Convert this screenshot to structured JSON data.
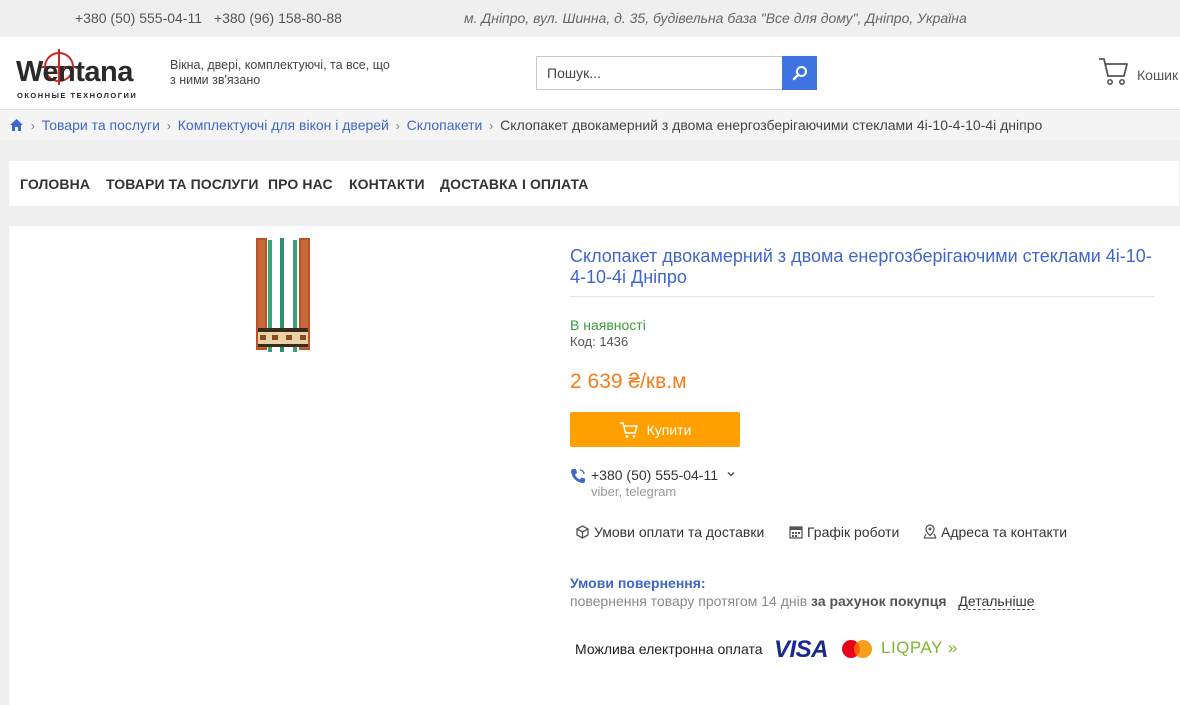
{
  "topbar": {
    "phone1": "+380 (50) 555-04-11",
    "phone2": "+380 (96) 158-80-88",
    "address": "м. Дніпро, вул. Шинна, д. 35, будівельна база \"Все для дому\", Дніпро, Україна"
  },
  "header": {
    "logo_text": "Wentana",
    "logo_sub": "ОКОННЫЕ ТЕХНОЛОГИИ",
    "tagline": "Вікна, двері, комплектуючі, та все, що з ними зв'язано",
    "search_placeholder": "Пошук...",
    "cart_label": "Кошик"
  },
  "breadcrumb": {
    "items": [
      "Товари та послуги",
      "Комплектуючі для вікон і дверей",
      "Склопакети"
    ],
    "current": "Склопакет двокамерний з двома енергозберігаючими стеклами 4і-10-4-10-4і дніпро"
  },
  "nav": {
    "items": [
      "ГОЛОВНА",
      "ТОВАРИ ТА ПОСЛУГИ",
      "ПРО НАС",
      "КОНТАКТИ",
      "ДОСТАВКА І ОПЛАТА"
    ]
  },
  "product": {
    "title": "Склопакет двокамерний з двома енергозберігаючими стеклами 4і-10-4-10-4і Дніпро",
    "stock": "В наявності",
    "code": "Код: 1436",
    "price": "2 639 ₴/кв.м",
    "buy_label": "Купити",
    "phone": "+380 (50) 555-04-11",
    "messengers": "viber, telegram",
    "links": [
      "Умови оплати та доставки",
      "Графік роботи",
      "Адреса та контакти"
    ],
    "returns_title": "Умови повернення:",
    "returns_text": "повернення товару протягом 14 днів",
    "returns_bold": "за рахунок покупця",
    "returns_more": "Детальніше",
    "payment_label": "Можлива електронна оплата",
    "payment_visa": "VISA",
    "payment_liqpay": "LIQPAY"
  },
  "colors": {
    "accent_blue": "#3f67c9",
    "search_button": "#3f74e0",
    "buy_button": "#ffa000",
    "price": "#f27e1d",
    "in_stock": "#3a9a3a"
  }
}
